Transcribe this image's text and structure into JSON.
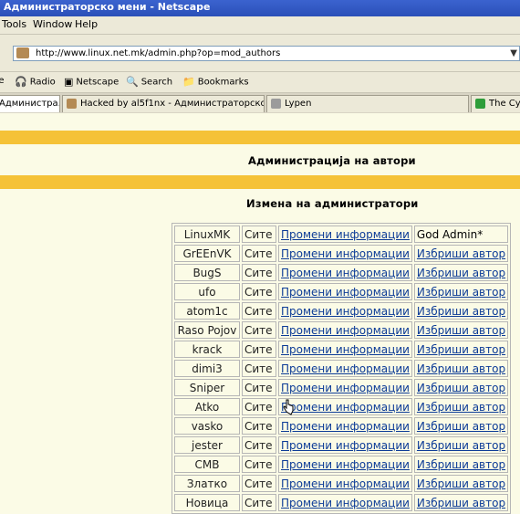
{
  "window": {
    "title": "Администраторско мени - Netscape"
  },
  "menu": {
    "items": [
      "Tools",
      "Window",
      "Help"
    ]
  },
  "address": {
    "url": "http://www.linux.net.mk/admin.php?op=mod_authors"
  },
  "bookmarks": {
    "items": [
      "Radio",
      "Netscape",
      "Search",
      "Bookmarks"
    ]
  },
  "tabs": [
    {
      "label": "Администра..."
    },
    {
      "label": "Hacked by al5f1nx - Администраторско ..."
    },
    {
      "label": "Lypen"
    },
    {
      "label": "The Cyb"
    }
  ],
  "page": {
    "admin_title": "Администрација на автори",
    "section_title": "Измена на администратори"
  },
  "authors": {
    "rows": [
      {
        "name": "LinuxMK",
        "perm": "Сите",
        "edit": "Промени информации",
        "action": "God Admin*"
      },
      {
        "name": "GrEEnVK",
        "perm": "Сите",
        "edit": "Промени информации",
        "action": "Избриши автор"
      },
      {
        "name": "BugS",
        "perm": "Сите",
        "edit": "Промени информации",
        "action": "Избриши автор"
      },
      {
        "name": "ufo",
        "perm": "Сите",
        "edit": "Промени информации",
        "action": "Избриши автор"
      },
      {
        "name": "atom1c",
        "perm": "Сите",
        "edit": "Промени информации",
        "action": "Избриши автор"
      },
      {
        "name": "Raso Pojov",
        "perm": "Сите",
        "edit": "Промени информации",
        "action": "Избриши автор"
      },
      {
        "name": "krack",
        "perm": "Сите",
        "edit": "Промени информации",
        "action": "Избриши автор"
      },
      {
        "name": "dimi3",
        "perm": "Сите",
        "edit": "Промени информации",
        "action": "Избриши автор"
      },
      {
        "name": "Sniper",
        "perm": "Сите",
        "edit": "Промени информации",
        "action": "Избриши автор"
      },
      {
        "name": "Atko",
        "perm": "Сите",
        "edit": "Промени информации",
        "action": "Избриши автор"
      },
      {
        "name": "vasko",
        "perm": "Сите",
        "edit": "Промени информации",
        "action": "Избриши автор"
      },
      {
        "name": "jester",
        "perm": "Сите",
        "edit": "Промени информации",
        "action": "Избриши автор"
      },
      {
        "name": "CMB",
        "perm": "Сите",
        "edit": "Промени информации",
        "action": "Избриши автор"
      },
      {
        "name": "Златко",
        "perm": "Сите",
        "edit": "Промени информации",
        "action": "Избриши автор"
      },
      {
        "name": "Новица",
        "perm": "Сите",
        "edit": "Промени информации",
        "action": "Избриши автор"
      }
    ]
  },
  "colors": {
    "stripe": "#f5c237",
    "page_bg": "#fbfbe6",
    "link": "#0c3b97"
  }
}
